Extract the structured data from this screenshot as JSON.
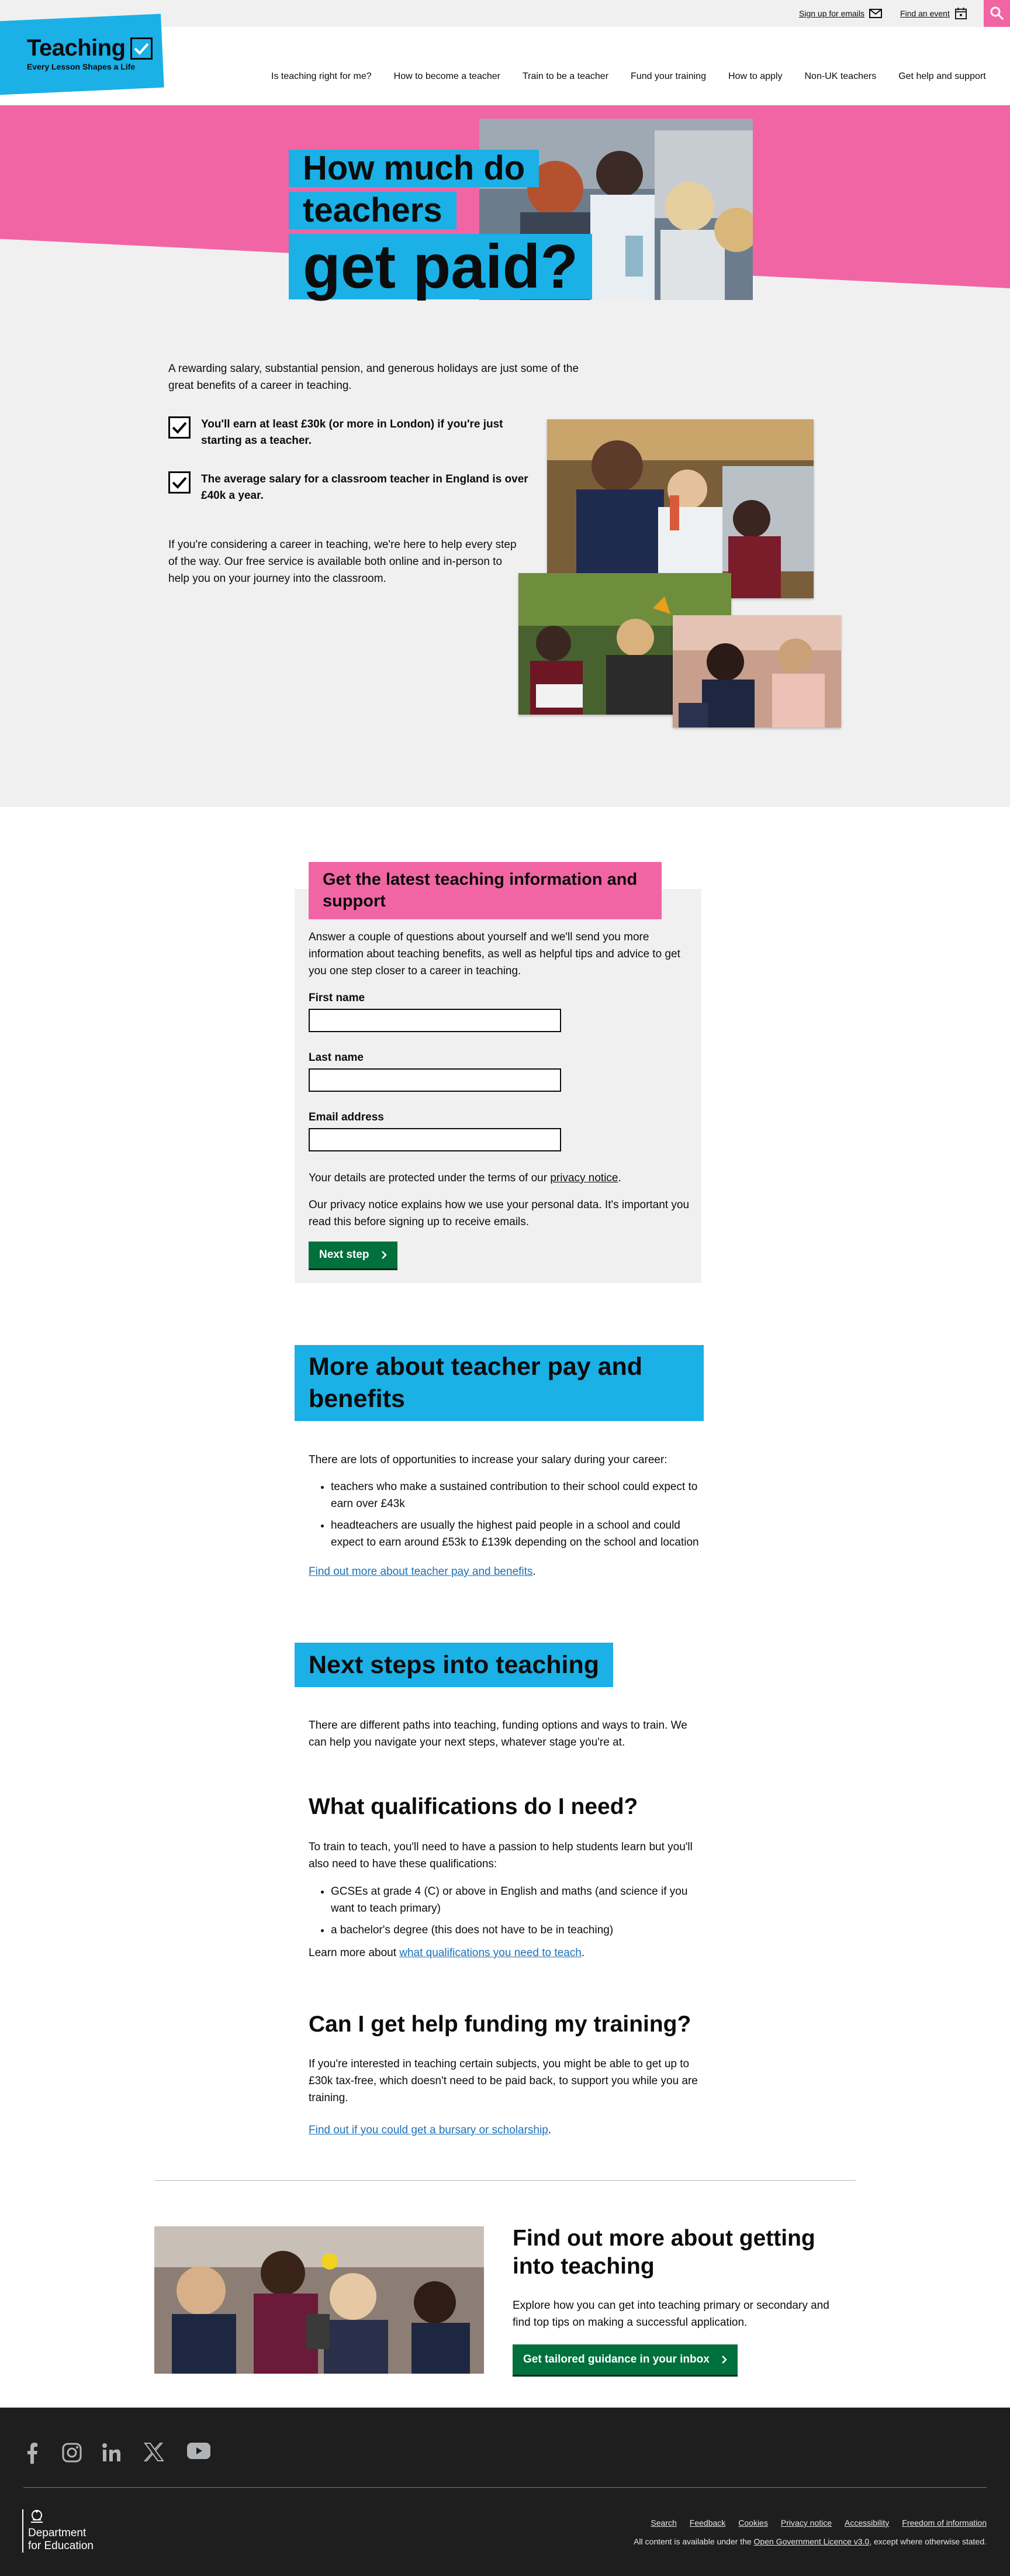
{
  "utility": {
    "sign_up": "Sign up for emails",
    "find_event": "Find an event"
  },
  "header": {
    "logo_title": "Teaching",
    "logo_tagline": "Every Lesson Shapes a Life",
    "nav": [
      "Is teaching right for me?",
      "How to become a teacher",
      "Train to be a teacher",
      "Fund your training",
      "How to apply",
      "Non-UK teachers",
      "Get help and support"
    ]
  },
  "hero": {
    "line1": "How much do",
    "line2": "teachers",
    "line3": "get paid?",
    "intro": "A rewarding salary, substantial pension, and generous holidays are just some of the great benefits of a career in teaching.",
    "check1": "You'll earn at least £30k (or more in London) if you're just starting as a teacher.",
    "check2": "The average salary for a classroom teacher in England is over £40k a year.",
    "consider": "If you're considering a career in teaching, we're here to help every step of the way. Our free service is available both online and in-person to help you on your journey into the classroom."
  },
  "mailing": {
    "heading": "Get the latest teaching information and support",
    "intro": "Answer a couple of questions about yourself and we'll send you more information about teaching benefits, as well as helpful tips and advice to get you one step closer to a career in teaching.",
    "first_name_label": "First name",
    "first_name_value": "",
    "last_name_label": "Last name",
    "last_name_value": "",
    "email_label": "Email address",
    "email_value": "",
    "protected_prefix": "Your details are protected under the terms of our ",
    "privacy_link": "privacy notice",
    "protected_suffix": ".",
    "privacy_explainer": "Our privacy notice explains how we use your personal data. It's important you read this before signing up to receive emails.",
    "next_step": "Next step"
  },
  "pay": {
    "heading": "More about teacher pay and benefits",
    "intro": "There are lots of opportunities to increase your salary during your career:",
    "bullets": [
      "teachers who make a sustained contribution to their school could expect to earn over £43k",
      "headteachers are usually the highest paid people in a school and could expect to earn around £53k to £139k depending on the school and location"
    ],
    "link": "Find out more about teacher pay and benefits",
    "link_suffix": "."
  },
  "next_steps": {
    "heading": "Next steps into teaching",
    "intro": "There are different paths into teaching, funding options and ways to train. We can help you navigate your next steps, whatever stage you're at.",
    "qual_heading": "What qualifications do I need?",
    "qual_intro": "To train to teach, you'll need to have a passion to help students learn but you'll also need to have these qualifications:",
    "qual_bullets": [
      "GCSEs at grade 4 (C) or above in English and maths (and science if you want to teach primary)",
      "a bachelor's degree (this does not have to be in teaching)"
    ],
    "qual_learn_prefix": "Learn more about ",
    "qual_learn_link": "what qualifications you need to teach",
    "qual_learn_suffix": ".",
    "fund_heading": "Can I get help funding my training?",
    "fund_text": "If you're interested in teaching certain subjects, you might be able to get up to £30k tax-free, which doesn't need to be paid back, to support you while you are training.",
    "fund_link": "Find out if you could get a bursary or scholarship",
    "fund_link_suffix": "."
  },
  "promo": {
    "title": "Find out more about getting into teaching",
    "text": "Explore how you can get into teaching primary or secondary and find top tips on making a successful application.",
    "button": "Get tailored guidance in your inbox"
  },
  "footer": {
    "social": [
      "facebook-icon",
      "instagram-icon",
      "linkedin-icon",
      "x-icon",
      "youtube-icon"
    ],
    "dfe_line1": "Department",
    "dfe_line2": "for Education",
    "links": [
      "Search",
      "Feedback",
      "Cookies",
      "Privacy notice",
      "Accessibility",
      "Freedom of information"
    ],
    "licence_prefix": "All content is available under the ",
    "licence_link": "Open Government Licence v3.0",
    "licence_suffix": ", except where otherwise stated."
  },
  "colors": {
    "brand_blue": "#1bb0e6",
    "brand_pink": "#f265a5",
    "button_green": "#00703c",
    "link_blue": "#1d70b8",
    "footer_bg": "#1e1e1e"
  }
}
